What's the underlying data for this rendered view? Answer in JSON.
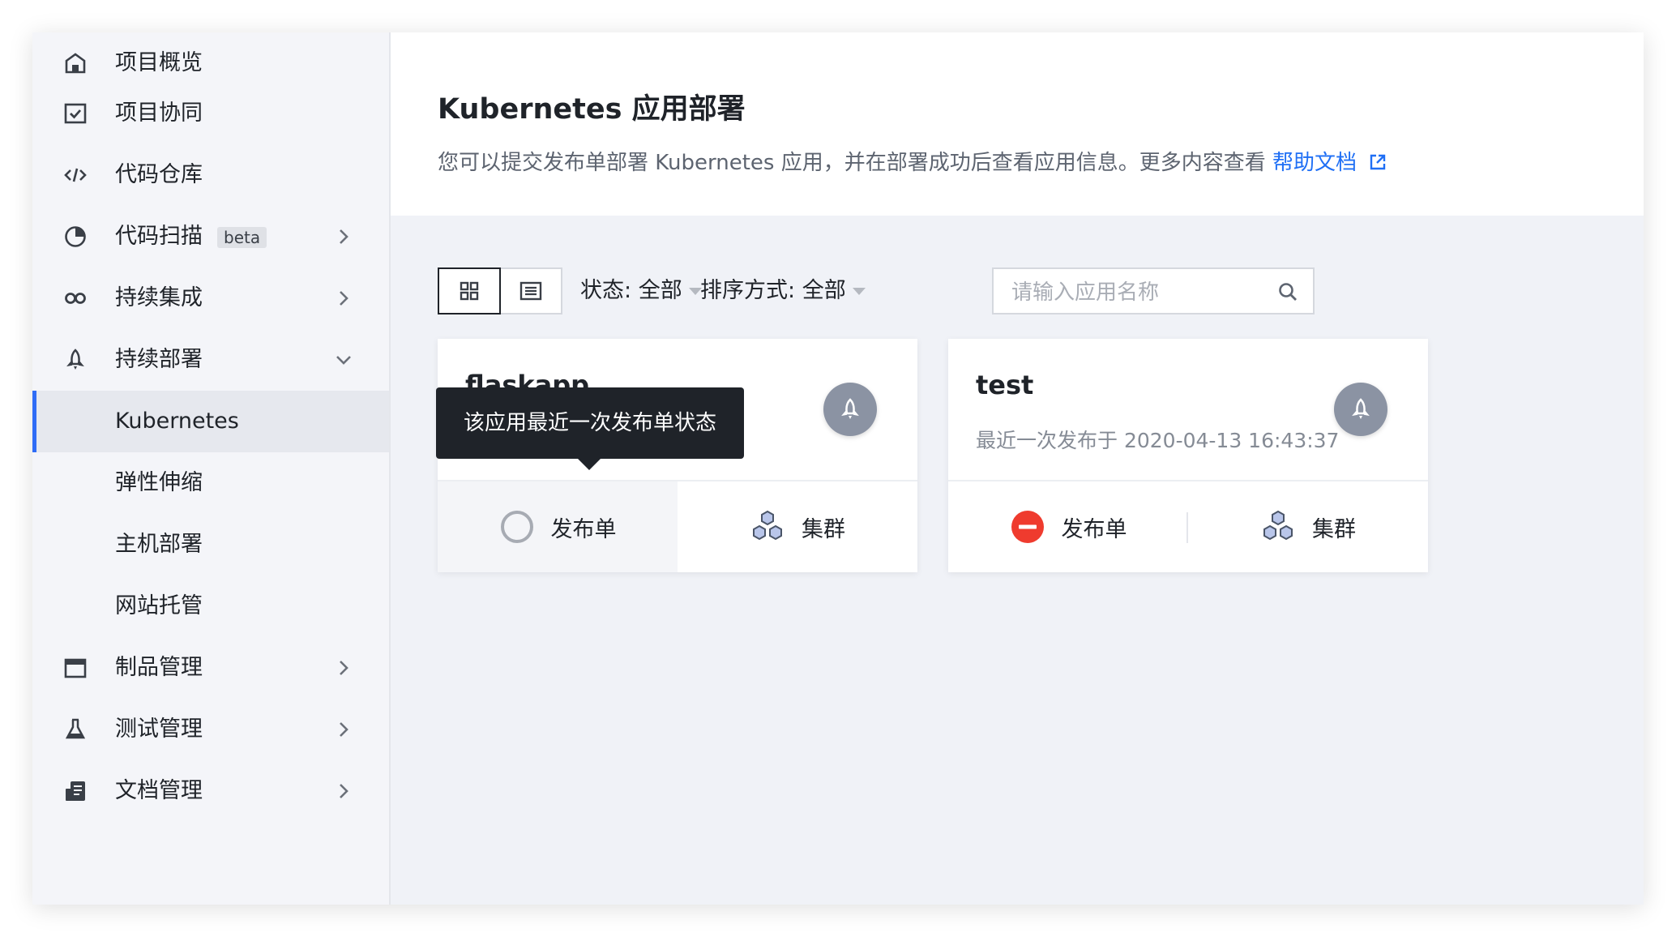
{
  "sidebar": {
    "items": [
      {
        "label": "项目概览",
        "icon": "home-icon"
      },
      {
        "label": "项目协同",
        "icon": "checkbox-icon"
      },
      {
        "label": "代码仓库",
        "icon": "code-icon"
      },
      {
        "label": "代码扫描",
        "icon": "scan-icon",
        "badge": "beta"
      },
      {
        "label": "持续集成",
        "icon": "infinity-icon"
      },
      {
        "label": "持续部署",
        "icon": "rocket-icon"
      },
      {
        "label": "Kubernetes"
      },
      {
        "label": "弹性伸缩"
      },
      {
        "label": "主机部署"
      },
      {
        "label": "网站托管"
      },
      {
        "label": "制品管理",
        "icon": "artifact-icon"
      },
      {
        "label": "测试管理",
        "icon": "flask-icon"
      },
      {
        "label": "文档管理",
        "icon": "document-icon"
      }
    ],
    "active": "Kubernetes"
  },
  "header": {
    "title": "Kubernetes 应用部署",
    "description": "您可以提交发布单部署 Kubernetes 应用，并在部署成功后查看应用信息。更多内容查看 ",
    "help_link": "帮助文档"
  },
  "toolbar": {
    "status_label": "状态:",
    "status_value": "全部",
    "sort_label": "排序方式:",
    "sort_value": "全部",
    "search_placeholder": "请输入应用名称"
  },
  "cards": [
    {
      "name": "flaskapp",
      "last_release": "",
      "release_label": "发布单",
      "release_status": "none",
      "cluster_label": "集群"
    },
    {
      "name": "test",
      "last_release": "最近一次发布于 2020-04-13 16:43:37",
      "release_label": "发布单",
      "release_status": "failed",
      "cluster_label": "集群"
    }
  ],
  "tooltip": "该应用最近一次发布单状态",
  "colors": {
    "accent": "#1f6ff5",
    "active_bar": "#2f6cf6",
    "failed": "#ef3b2e",
    "badge_gray": "#8b93a3"
  }
}
